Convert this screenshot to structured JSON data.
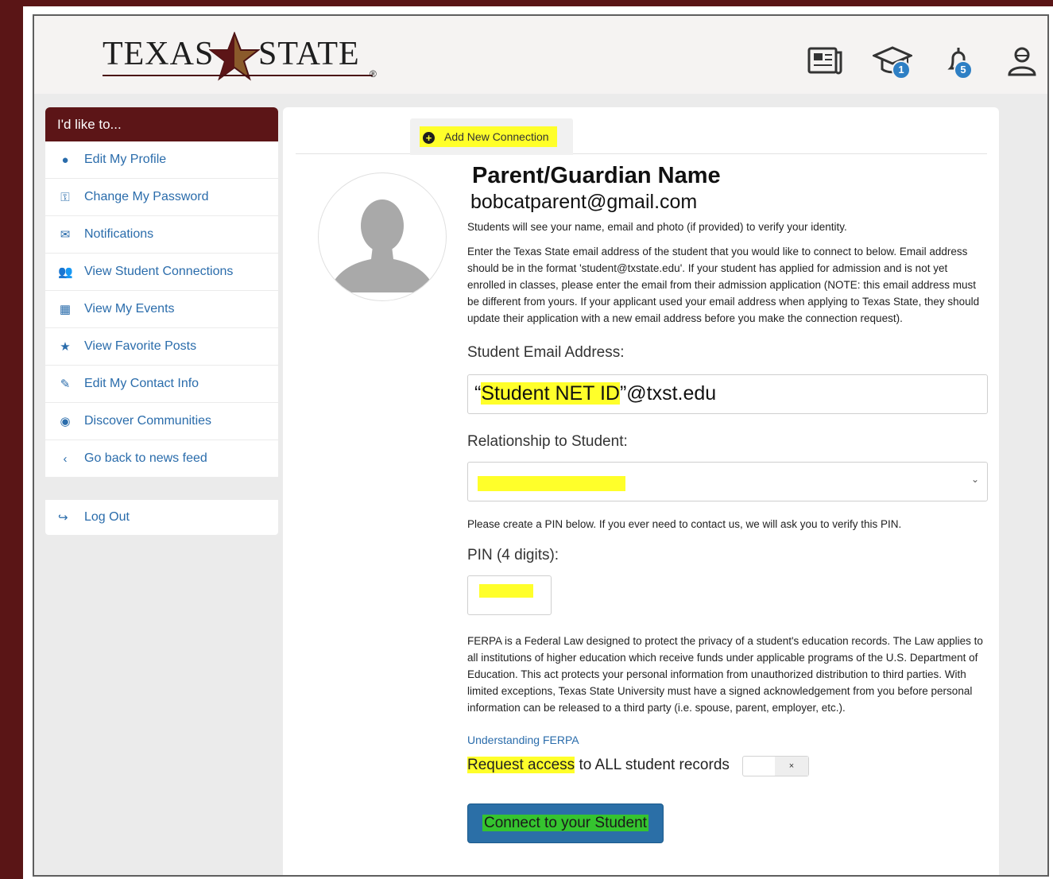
{
  "header": {
    "logo_left": "TEXAS",
    "logo_right": "STATE",
    "logo_reg": "®",
    "icons": [
      {
        "name": "news-icon",
        "badge": ""
      },
      {
        "name": "graduation-cap-icon",
        "badge": "1"
      },
      {
        "name": "bell-icon",
        "badge": "5"
      },
      {
        "name": "user-icon",
        "badge": ""
      }
    ]
  },
  "sidebar": {
    "title": "I'd like to...",
    "items": [
      {
        "label": "Edit My Profile",
        "icon": "user-circle-icon"
      },
      {
        "label": "Change My Password",
        "icon": "key-icon"
      },
      {
        "label": "Notifications",
        "icon": "envelope-icon"
      },
      {
        "label": "View Student Connections",
        "icon": "users-icon"
      },
      {
        "label": "View My Events",
        "icon": "calendar-icon"
      },
      {
        "label": "View Favorite Posts",
        "icon": "star-icon"
      },
      {
        "label": "Edit My Contact Info",
        "icon": "pencil-icon"
      },
      {
        "label": "Discover Communities",
        "icon": "compass-icon"
      },
      {
        "label": "Go back to news feed",
        "icon": "chevron-left-icon"
      }
    ],
    "logout": "Log Out"
  },
  "main": {
    "tab_label": "Add New Connection",
    "parent_name": "Parent/Guardian Name",
    "parent_email": "bobcatparent@gmail.com",
    "identity_note": "Students will see your name, email and photo (if provided) to verify your identity.",
    "instructions": "Enter the Texas State email address of the student that you would like to connect to below. Email address should be in the format 'student@txstate.edu'. If your student has applied for admission and is not yet enrolled in classes, please enter the email from their admission application (NOTE: this email address must be different from yours. If your applicant used your email address when applying to Texas State, they should update their application with a new email address before you make the connection request).",
    "student_email_label": "Student Email Address:",
    "student_email_open_quote": "“",
    "student_email_highlight": "Student NET ID",
    "student_email_rest": "”@txst.edu",
    "relationship_label": "Relationship to Student:",
    "relationship_value": "",
    "pin_note": "Please create a PIN below. If you ever need to contact us, we will ask you to verify this PIN.",
    "pin_label": "PIN (4 digits):",
    "pin_value": "",
    "ferpa_text": "FERPA is a Federal Law designed to protect the privacy of a student's education records. The Law applies to all institutions of higher education which receive funds under applicable programs of the U.S. Department of Education. This act protects your personal information from unauthorized distribution to third parties. With limited exceptions, Texas State University must have a signed acknowledgement from you before personal information can be released to a third party (i.e. spouse, parent, employer, etc.).",
    "ferpa_link": "Understanding FERPA",
    "request_highlight": "Request access",
    "request_rest": " to ALL student records",
    "toggle_off_glyph": "×",
    "connect_button": "Connect to your Student"
  }
}
